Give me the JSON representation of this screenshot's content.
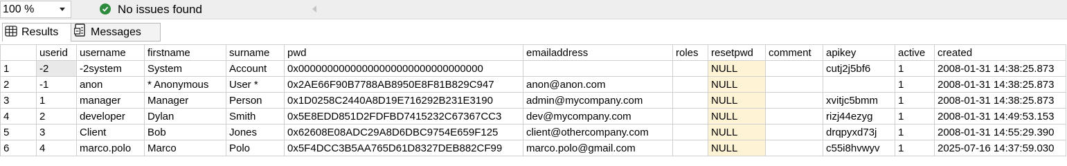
{
  "statusbar": {
    "zoom": "100 %",
    "status_text": "No issues found"
  },
  "tabs": [
    {
      "label": "Results"
    },
    {
      "label": "Messages"
    }
  ],
  "grid": {
    "columns": [
      "",
      "userid",
      "username",
      "firstname",
      "surname",
      "pwd",
      "emailaddress",
      "roles",
      "resetpwd",
      "comment",
      "apikey",
      "active",
      "created"
    ],
    "rows": [
      [
        "1",
        "-2",
        "-2system",
        "System",
        "Account",
        "0x00000000000000000000000000000000",
        "",
        "",
        "NULL",
        "",
        "cutj2j5bf6",
        "1",
        "2008-01-31 14:38:25.873"
      ],
      [
        "2",
        "-1",
        "anon",
        "* Anonymous",
        "User *",
        "0x2AE66F90B7788AB8950E8F81B829C947",
        "anon@anon.com",
        "",
        "NULL",
        "",
        "",
        "1",
        "2008-01-31 14:38:25.873"
      ],
      [
        "3",
        "1",
        "manager",
        "Manager",
        "Person",
        "0x1D0258C2440A8D19E716292B231E3190",
        "admin@mycompany.com",
        "",
        "NULL",
        "",
        "xvitjc5bmm",
        "1",
        "2008-01-31 14:38:25.873"
      ],
      [
        "4",
        "2",
        "developer",
        "Dylan",
        "Smith",
        "0x5E8EDD851D2FDFBD7415232C67367CC3",
        "dev@mycompany.com",
        "",
        "NULL",
        "",
        "rizj44ezyg",
        "1",
        "2008-01-31 14:49:53.153"
      ],
      [
        "5",
        "3",
        "Client",
        "Bob",
        "Jones",
        "0x62608E08ADC29A8D6DBC9754E659F125",
        "client@othercompany.com",
        "",
        "NULL",
        "",
        "drqpyxd73j",
        "1",
        "2008-01-31 14:55:29.390"
      ],
      [
        "6",
        "4",
        "marco.polo",
        "Marco",
        "Polo",
        "0x5F4DCC3B5AA765D61D8327DEB882CF99",
        "marco.polo@gmail.com",
        "",
        "NULL",
        "",
        "c55i8hvwyv",
        "1",
        "2025-07-16 14:37:59.030"
      ]
    ]
  },
  "colors": {
    "null_cell": "#fff3d6",
    "status_ok": "#2e8b3d"
  }
}
